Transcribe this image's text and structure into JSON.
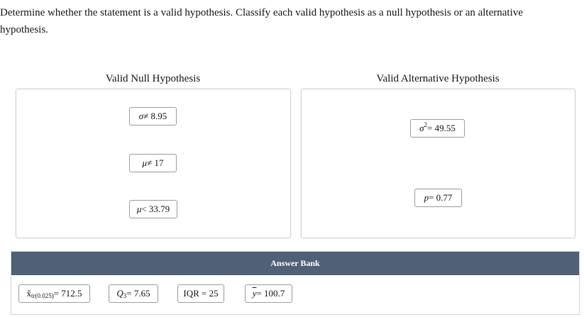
{
  "instructions": "Determine whether the statement is a valid hypothesis. Classify each valid hypothesis as a null hypothesis or an alternative hypothesis.",
  "columns": {
    "null_title": "Valid Null Hypothesis",
    "alt_title": "Valid Alternative Hypothesis"
  },
  "null_zone": {
    "items": [
      {
        "sym": "σ",
        "rest": " ≠ 8.95"
      },
      {
        "sym": "μ",
        "rest": " ≠ 17"
      },
      {
        "sym": "μ",
        "rest": " < 33.79"
      }
    ]
  },
  "alt_zone": {
    "items": [
      {
        "sym": "σ",
        "sup": "2",
        "rest": " = 49.55"
      },
      {
        "sym": "p",
        "rest": " = 0.77"
      }
    ]
  },
  "answer_bank": {
    "title": "Answer Bank",
    "items": [
      {
        "sym": "x̃",
        "sub": "tr(0.025)",
        "rest": " = 712.5"
      },
      {
        "sym": "Q",
        "sub": "3",
        "rest": " = 7.65"
      },
      {
        "text": "IQR = 25"
      },
      {
        "sym": "y",
        "rest": " = 100.7"
      }
    ]
  }
}
